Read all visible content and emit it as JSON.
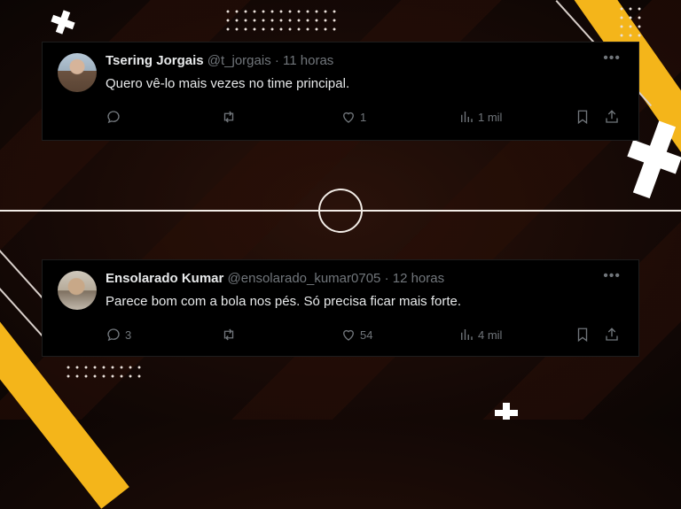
{
  "tweets": [
    {
      "name": "Tsering Jorgais",
      "handle": "@t_jorgais",
      "time": "11 horas",
      "separator": "·",
      "text": "Quero vê-lo mais vezes no time principal.",
      "replies": "",
      "retweets": "",
      "likes": "1",
      "views": "1 mil",
      "more_icon": "•••"
    },
    {
      "name": "Ensolarado Kumar",
      "handle": "@ensolarado_kumar0705",
      "time": "12 horas",
      "separator": "·",
      "text": "Parece bom com a bola nos pés. Só precisa ficar mais forte.",
      "replies": "3",
      "retweets": "",
      "likes": "54",
      "views": "4 mil",
      "more_icon": "•••"
    }
  ],
  "colors": {
    "accent_yellow": "#f4b51a",
    "card_bg": "#000000",
    "text_primary": "#e7e9ea",
    "text_secondary": "#71767b"
  },
  "icons": [
    "reply-icon",
    "retweet-icon",
    "like-icon",
    "views-icon",
    "bookmark-icon",
    "share-icon",
    "more-icon"
  ]
}
